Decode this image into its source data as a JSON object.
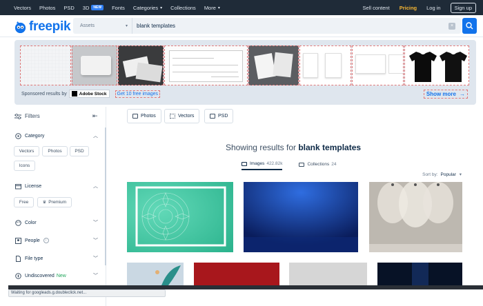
{
  "nav": {
    "items": [
      "Vectors",
      "Photos",
      "PSD",
      "3D",
      "Fonts",
      "Categories",
      "Collections",
      "More"
    ],
    "badge_new": "NEW",
    "sell": "Sell content",
    "pricing": "Pricing",
    "login": "Log in",
    "signup": "Sign up"
  },
  "header": {
    "logo": "freepik",
    "assets": "Assets",
    "query": "blank templates"
  },
  "sponsored": {
    "label": "Sponsored results by",
    "adobe": "Adobe Stock",
    "free_link": "Get 10 free images",
    "show_more": "Show more"
  },
  "sidebar": {
    "filters": "Filters",
    "category": "Category",
    "category_pills": [
      "Vectors",
      "Photos",
      "PSD",
      "Icons"
    ],
    "license": "License",
    "license_pills": [
      "Free",
      "Premium"
    ],
    "color": "Color",
    "people": "People",
    "file_type": "File type",
    "undiscovered": "Undiscovered",
    "new_label": "New"
  },
  "type_buttons": [
    "Photos",
    "Vectors",
    "PSD"
  ],
  "results": {
    "prefix": "Showing results for",
    "query": "blank templates",
    "tab_images": "Images",
    "images_count": "422.82k",
    "tab_collections": "Collections",
    "collections_count": "24",
    "sort_label": "Sort by:",
    "sort_value": "Popular"
  },
  "status": "Waiting for googleads.g.doubleclick.net...",
  "colors": {
    "brand": "#1273eb",
    "nav_bg": "#1f2b38",
    "pricing": "#f5b532"
  }
}
